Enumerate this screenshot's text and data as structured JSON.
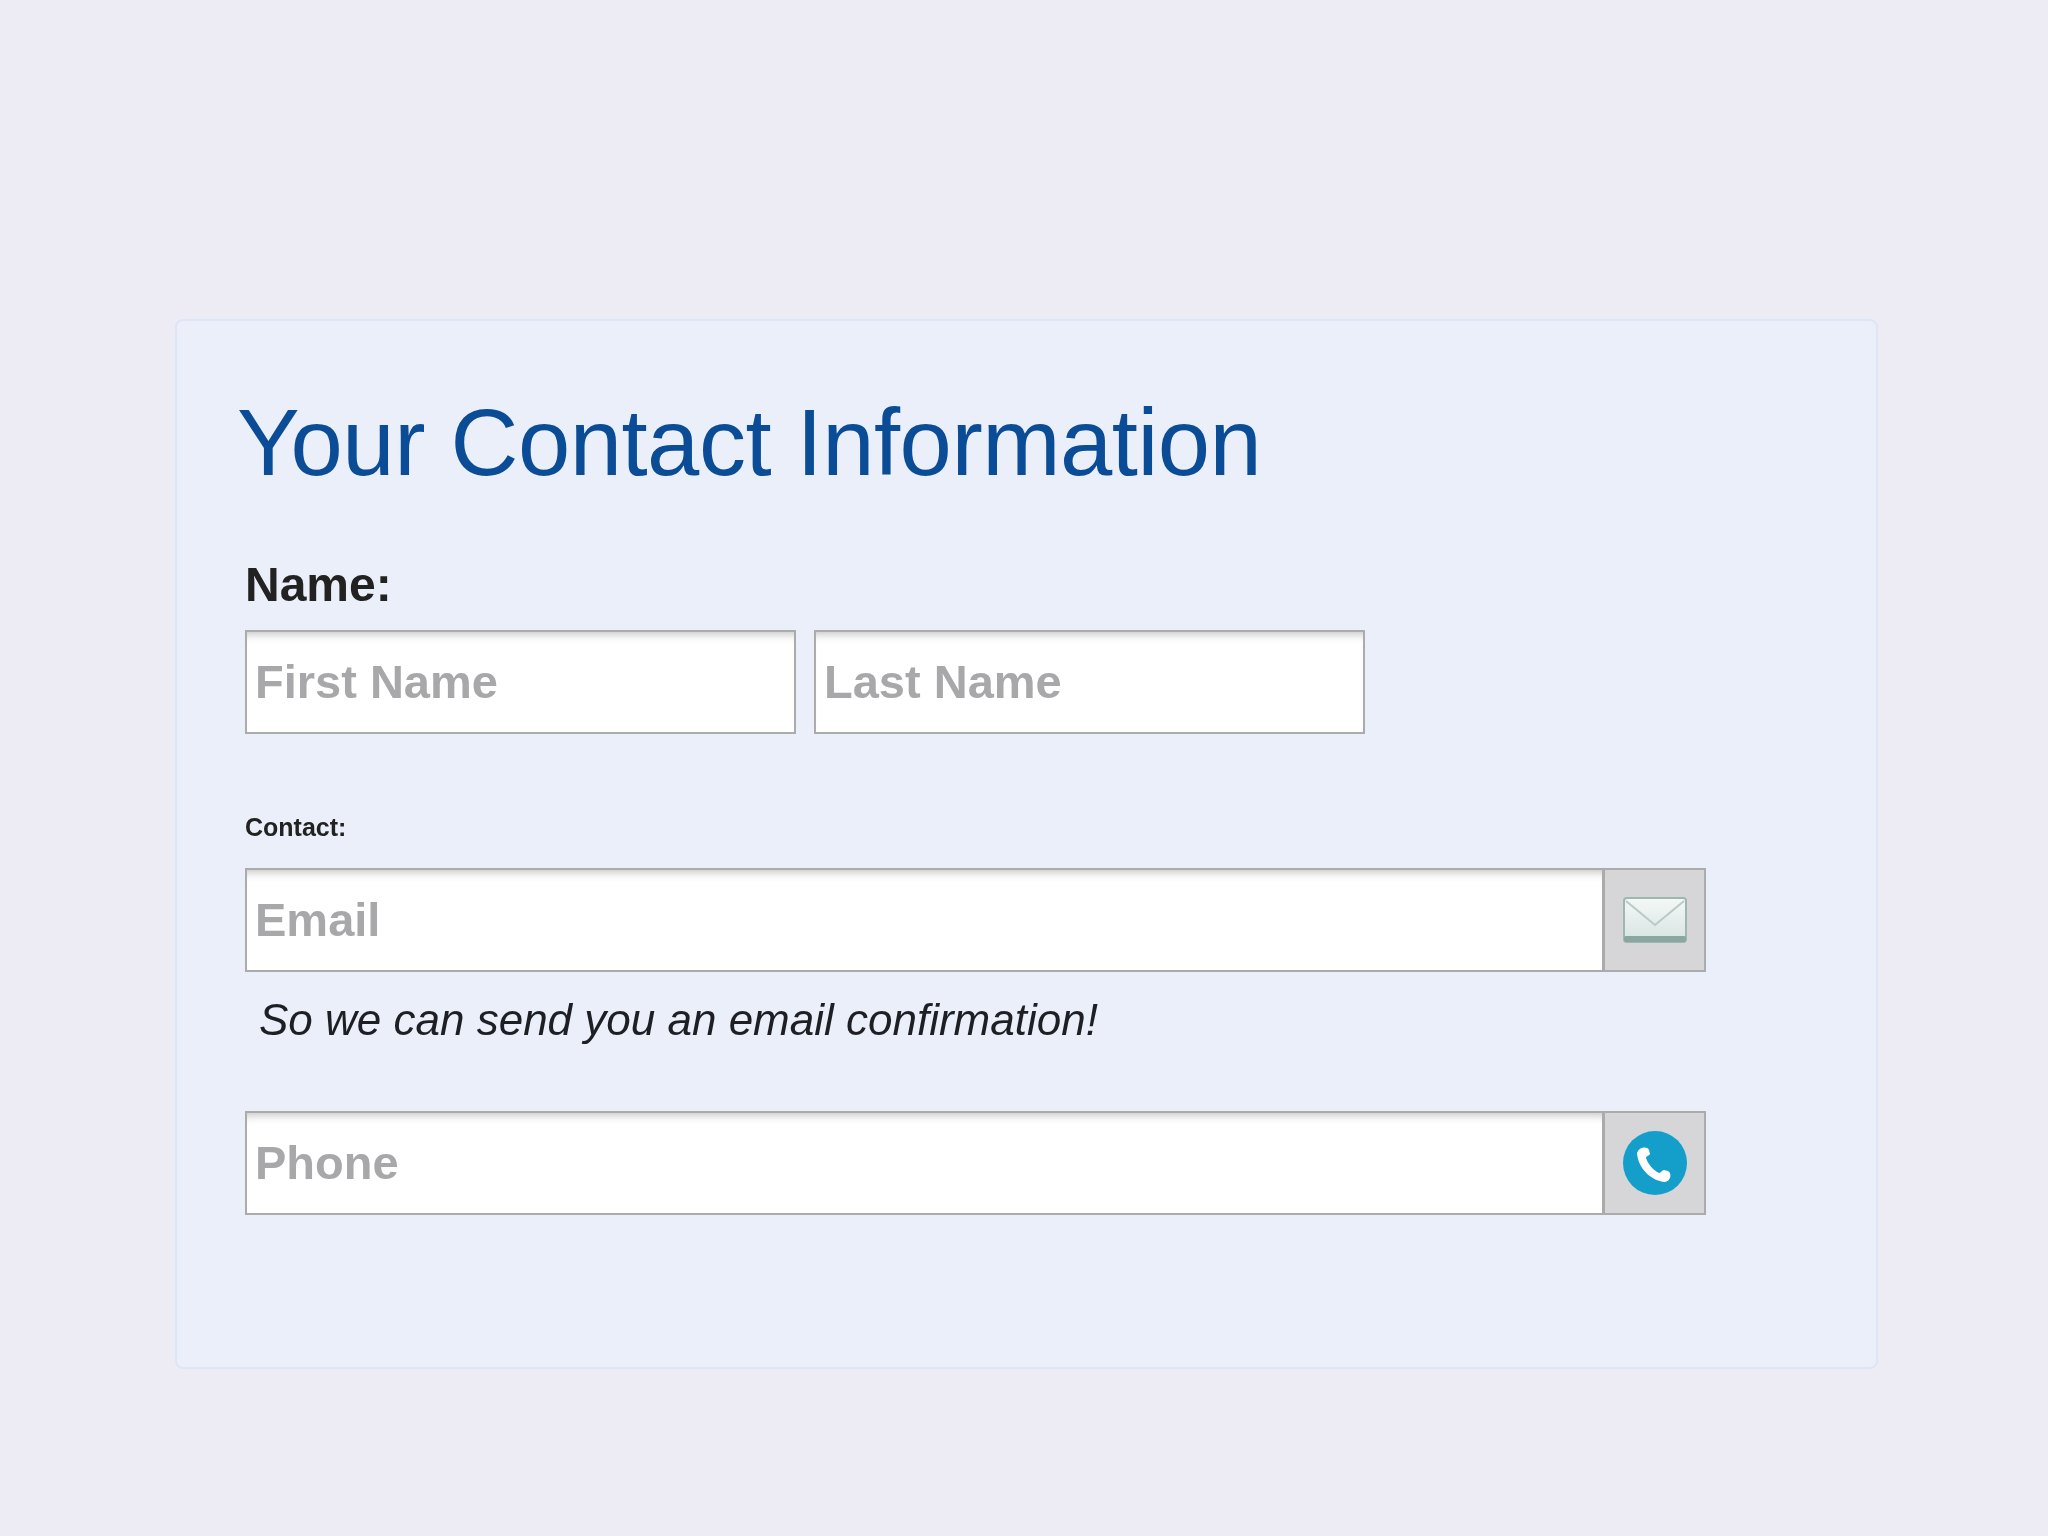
{
  "title": "Your Contact Information",
  "name_group": {
    "label": "Name:",
    "inputs": [
      {
        "placeholder": "First Name"
      },
      {
        "placeholder": "Last Name"
      }
    ]
  },
  "contact_group": {
    "label": "Contact:",
    "fields": [
      {
        "kind": "email",
        "placeholder": "Email",
        "help": "So we can send you an email confirmation!"
      },
      {
        "kind": "phone",
        "placeholder": "Phone"
      }
    ]
  }
}
